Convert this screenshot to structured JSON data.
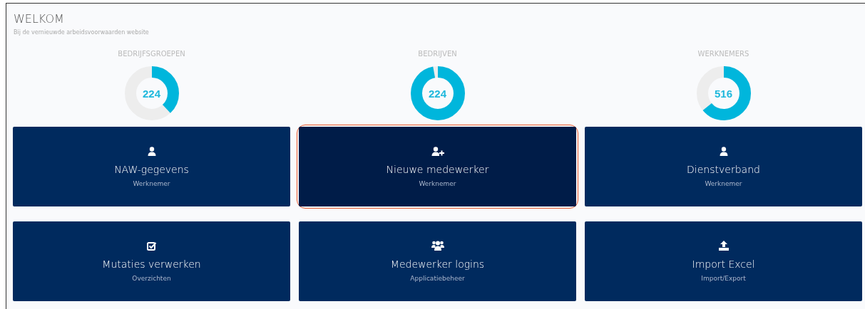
{
  "header": {
    "title": "WELKOM",
    "subtitle": "Bij de vernieuwde arbeidsvoorwaarden website"
  },
  "stats": [
    {
      "label": "BEDRIJFSGROEPEN",
      "value": "224",
      "level": 0.38
    },
    {
      "label": "BEDRIJVEN",
      "value": "224",
      "level": 0.97
    },
    {
      "label": "WERKNEMERS",
      "value": "516",
      "level": 0.64
    }
  ],
  "tiles": [
    {
      "kind": "user",
      "title": "NAW-gegevens",
      "subtitle": "Werknemer",
      "selected": false
    },
    {
      "kind": "user-plus",
      "title": "Nieuwe medewerker",
      "subtitle": "Werknemer",
      "selected": true
    },
    {
      "kind": "user",
      "title": "Dienstverband",
      "subtitle": "Werknemer",
      "selected": false
    },
    {
      "kind": "checkbox",
      "title": "Mutaties verwerken",
      "subtitle": "Overzichten",
      "selected": false
    },
    {
      "kind": "users",
      "title": "Medewerker logins",
      "subtitle": "Applicatiebeheer",
      "selected": false
    },
    {
      "kind": "upload",
      "title": "Import Excel",
      "subtitle": "Import/Export",
      "selected": false
    }
  ]
}
